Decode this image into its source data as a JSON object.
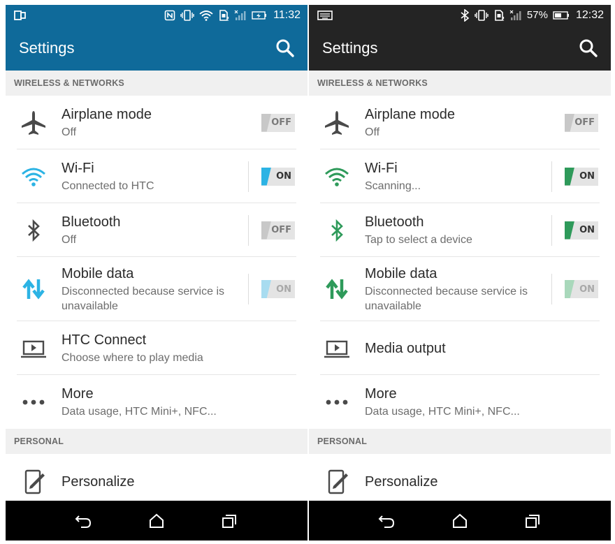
{
  "colors": {
    "left_accent": "#0f6a9a",
    "right_accent": "#242424",
    "left_icon": "#2cb3e4",
    "right_icon": "#2e9a5a",
    "gray_icon": "#4a4a4a"
  },
  "left": {
    "status": {
      "time": "11:32"
    },
    "title": "Settings",
    "section_wireless": "WIRELESS & NETWORKS",
    "airplane": {
      "title": "Airplane mode",
      "subtitle": "Off",
      "toggle": "OFF"
    },
    "wifi": {
      "title": "Wi-Fi",
      "subtitle": "Connected to HTC",
      "toggle": "ON"
    },
    "bluetooth": {
      "title": "Bluetooth",
      "subtitle": "Off",
      "toggle": "OFF"
    },
    "mobile": {
      "title": "Mobile data",
      "subtitle": "Disconnected because service is unavailable",
      "toggle": "ON"
    },
    "media": {
      "title": "HTC Connect",
      "subtitle": "Choose where to play media"
    },
    "more": {
      "title": "More",
      "subtitle": "Data usage, HTC Mini+, NFC..."
    },
    "section_personal": "PERSONAL",
    "personalize": {
      "title": "Personalize"
    }
  },
  "right": {
    "status": {
      "time": "12:32",
      "battery": "57%"
    },
    "title": "Settings",
    "section_wireless": "WIRELESS & NETWORKS",
    "airplane": {
      "title": "Airplane mode",
      "subtitle": "Off",
      "toggle": "OFF"
    },
    "wifi": {
      "title": "Wi-Fi",
      "subtitle": "Scanning...",
      "toggle": "ON"
    },
    "bluetooth": {
      "title": "Bluetooth",
      "subtitle": "Tap to select a device",
      "toggle": "ON"
    },
    "mobile": {
      "title": "Mobile data",
      "subtitle": "Disconnected because service is unavailable",
      "toggle": "ON"
    },
    "media": {
      "title": "Media output"
    },
    "more": {
      "title": "More",
      "subtitle": "Data usage, HTC Mini+, NFC..."
    },
    "section_personal": "PERSONAL",
    "personalize": {
      "title": "Personalize"
    }
  },
  "icons": [
    "screen-mirror-icon",
    "nfc-icon",
    "vibrate-icon",
    "wifi-icon",
    "sim-icon",
    "signal-icon",
    "battery-icon",
    "keyboard-icon",
    "bluetooth-icon",
    "search-icon",
    "airplane-icon",
    "mobile-data-icon",
    "media-output-icon",
    "more-icon",
    "personalize-icon",
    "back-icon",
    "home-icon",
    "recents-icon"
  ]
}
